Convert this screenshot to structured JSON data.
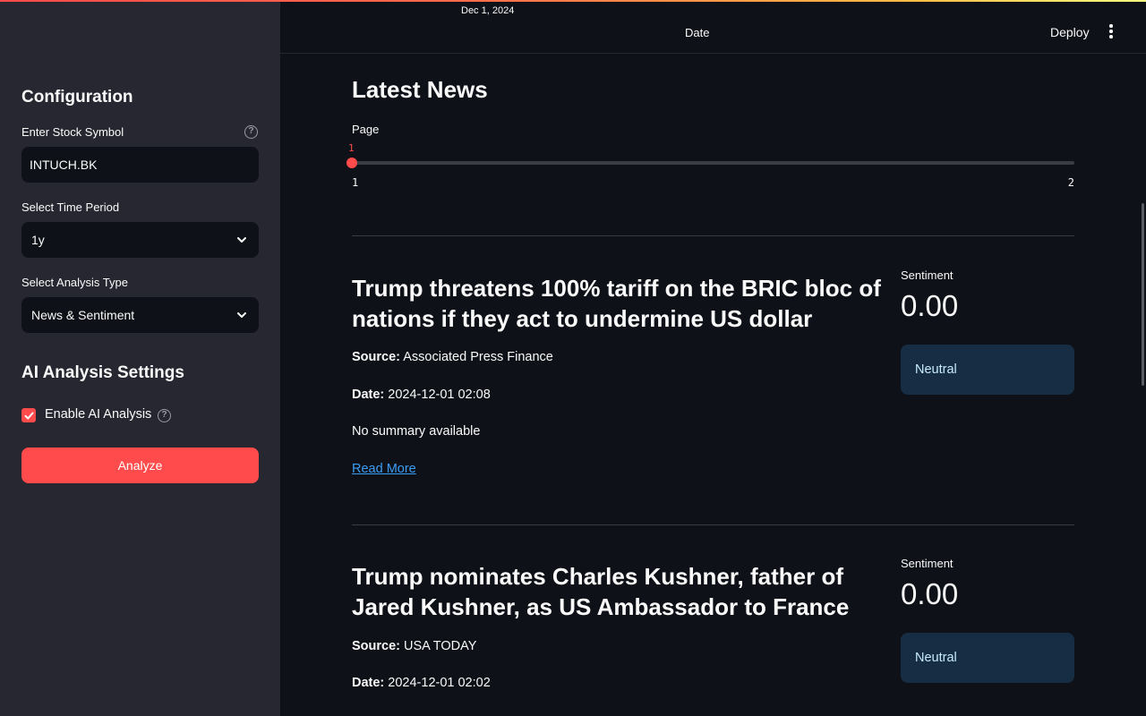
{
  "sidebar": {
    "configuration_heading": "Configuration",
    "stock_symbol_label": "Enter Stock Symbol",
    "stock_symbol_value": "INTUCH.BK",
    "time_period_label": "Select Time Period",
    "time_period_value": "1y",
    "analysis_type_label": "Select Analysis Type",
    "analysis_type_value": "News & Sentiment",
    "ai_settings_heading": "AI Analysis Settings",
    "enable_ai_label": "Enable AI Analysis",
    "enable_ai_checked": true,
    "analyze_button": "Analyze",
    "help_icon_glyph": "?"
  },
  "header": {
    "date_value": "Dec 1, 2024",
    "date_label": "Date",
    "deploy_label": "Deploy",
    "menu_icon": "kebab-menu-icon"
  },
  "main": {
    "title": "Latest News",
    "page_slider": {
      "label": "Page",
      "value": "1",
      "min": "1",
      "max": "2"
    },
    "articles": [
      {
        "title": "Trump threatens 100% tariff on the BRIC bloc of nations if they act to undermine US dollar",
        "source_label": "Source:",
        "source": "Associated Press Finance",
        "date_label": "Date:",
        "date": "2024-12-01 02:08",
        "summary": "No summary available",
        "read_more": "Read More",
        "sentiment_label": "Sentiment",
        "sentiment_value": "0.00",
        "sentiment_class": "Neutral"
      },
      {
        "title": "Trump nominates Charles Kushner, father of Jared Kushner, as US Ambassador to France",
        "source_label": "Source:",
        "source": "USA TODAY",
        "date_label": "Date:",
        "date": "2024-12-01 02:02",
        "sentiment_label": "Sentiment",
        "sentiment_value": "0.00",
        "sentiment_class": "Neutral"
      }
    ]
  },
  "colors": {
    "accent": "#ff4b4b",
    "background": "#0e1117",
    "sidebar": "#262730",
    "link": "#3d9df5",
    "neutral_box": "#172d43"
  }
}
